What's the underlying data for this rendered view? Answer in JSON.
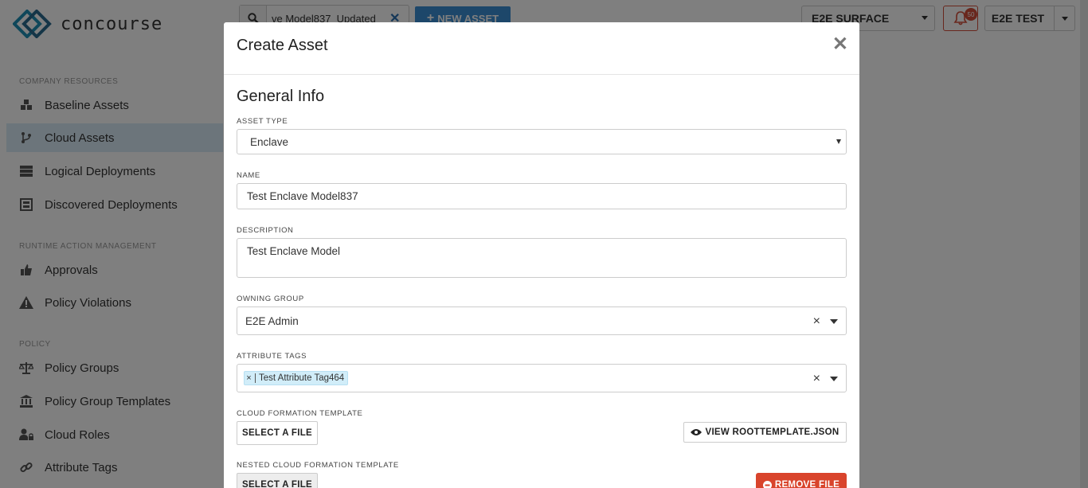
{
  "app": {
    "brand": "concourse"
  },
  "sidebar": {
    "sections": [
      {
        "title": "COMPANY RESOURCES",
        "items": [
          {
            "label": "Baseline Assets",
            "icon": "cubes-icon"
          },
          {
            "label": "Cloud Assets",
            "icon": "branch-icon",
            "active": true
          },
          {
            "label": "Logical Deployments",
            "icon": "server-icon"
          },
          {
            "label": "Discovered Deployments",
            "icon": "discovered-icon"
          }
        ]
      },
      {
        "title": "RUNTIME ACTION MANAGEMENT",
        "items": [
          {
            "label": "Approvals",
            "icon": "thumbs-up-icon"
          },
          {
            "label": "Policy Violations",
            "icon": "warning-icon"
          }
        ]
      },
      {
        "title": "POLICY",
        "items": [
          {
            "label": "Policy Groups",
            "icon": "scale-icon"
          },
          {
            "label": "Policy Group Templates",
            "icon": "bank-icon"
          },
          {
            "label": "Cloud Roles",
            "icon": "users-lock-icon"
          },
          {
            "label": "Attribute Tags",
            "icon": "link-icon"
          }
        ]
      }
    ]
  },
  "topbar": {
    "search_value": "ve Model837_Updated",
    "new_asset_label": "NEW ASSET",
    "environment": "E2E SURFACE",
    "notification_count": "50",
    "user": "E2E TEST"
  },
  "modal": {
    "title": "Create Asset",
    "section_title": "General Info",
    "asset_type": {
      "label": "ASSET TYPE",
      "value": "Enclave"
    },
    "name": {
      "label": "NAME",
      "value": "Test Enclave Model837"
    },
    "description": {
      "label": "DESCRIPTION",
      "value": "Test Enclave Model"
    },
    "owning_group": {
      "label": "OWNING GROUP",
      "value": "E2E Admin"
    },
    "attribute_tags": {
      "label": "ATTRIBUTE TAGS",
      "tags": [
        "Test Attribute Tag464"
      ]
    },
    "cloud_formation": {
      "label": "CLOUD FORMATION TEMPLATE",
      "select_label": "SELECT A FILE",
      "view_label": "VIEW ROOTTEMPLATE.JSON"
    },
    "nested_cloud_formation": {
      "label": "NESTED CLOUD FORMATION TEMPLATE",
      "select_label": "SELECT A FILE",
      "remove_label": "REMOVE FILE"
    }
  },
  "colors": {
    "primary": "#3a8fd4",
    "active_nav": "#d9ebf7",
    "danger": "#d9442c",
    "tag_chip": "#d1edf9"
  }
}
